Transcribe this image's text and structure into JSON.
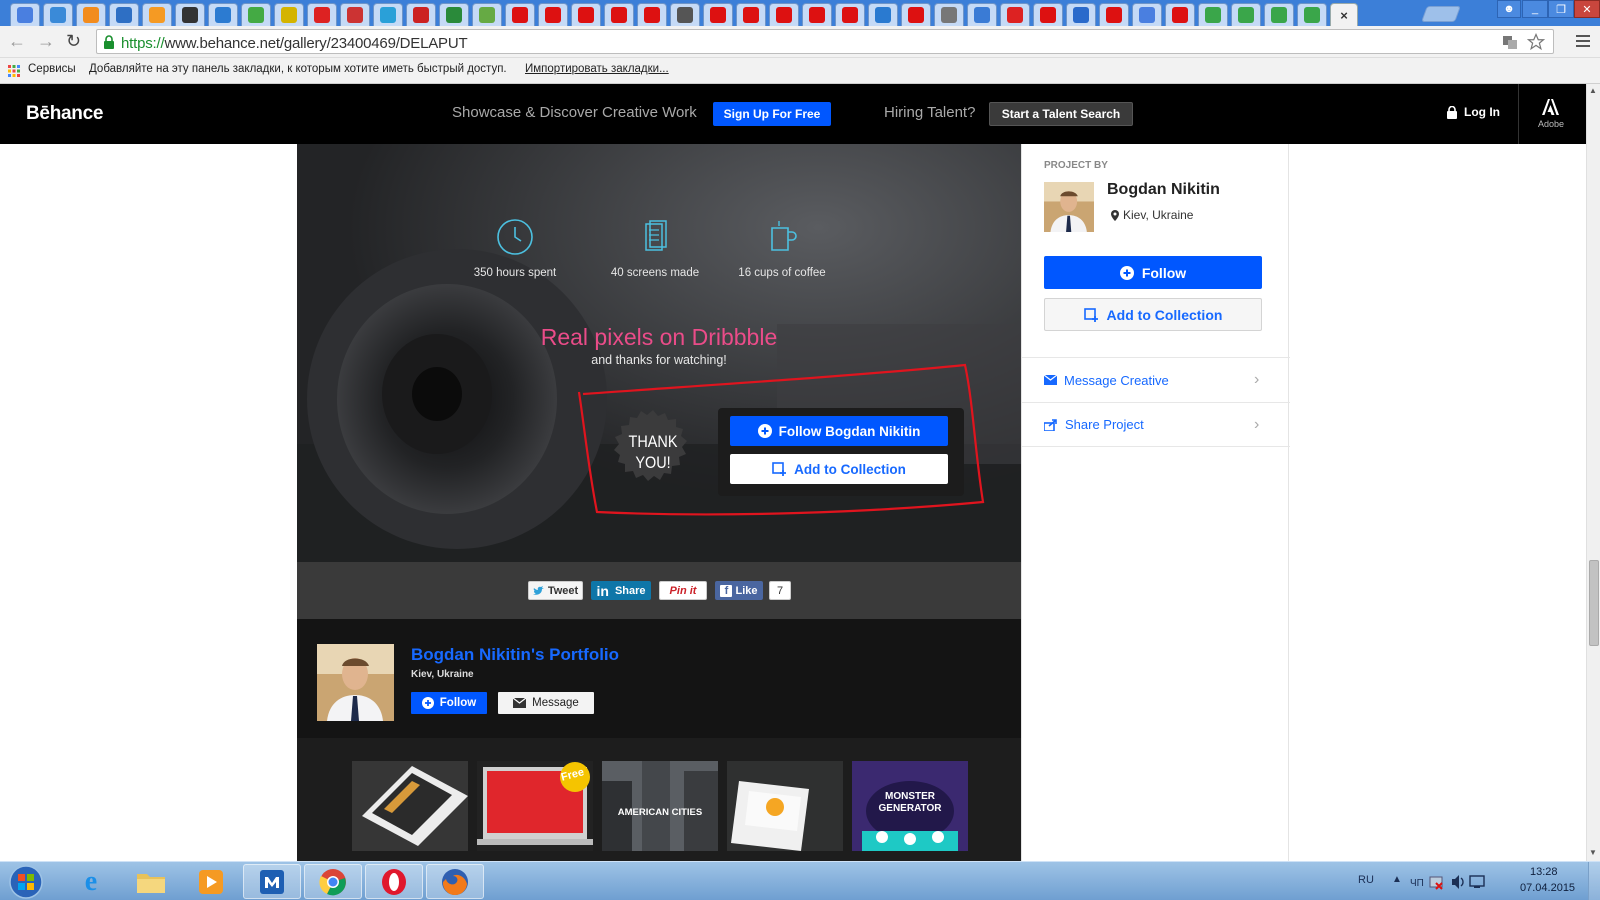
{
  "browser": {
    "active_tab_close": "×",
    "url_scheme": "https://",
    "url_rest": "www.behance.net/gallery/23400469/DELAPUT",
    "bookmarks_apps": "Сервисы",
    "bookmarks_hint": "Добавляйте на эту панель закладки, к которым хотите иметь быстрый доступ.",
    "bookmarks_import": "Импортировать закладки..."
  },
  "header": {
    "logo": "Bēhance",
    "tagline": "Showcase & Discover Creative Work",
    "signup": "Sign Up For Free",
    "hiring": "Hiring Talent?",
    "talent_search": "Start a Talent Search",
    "login": "Log In",
    "adobe": "Adobe"
  },
  "hero": {
    "stats": [
      {
        "text": "350 hours spent",
        "icon": "clock-icon"
      },
      {
        "text": "40 screens made",
        "icon": "screens-icon"
      },
      {
        "text": "16 cups of coffee",
        "icon": "coffee-cup-icon"
      }
    ],
    "title": "Real pixels on Dribbble",
    "subtitle": "and thanks for watching!",
    "badge": "THANK YOU!",
    "follow": "Follow Bogdan Nikitin",
    "add": "Add to Collection",
    "annotation_color": "#e0141e"
  },
  "share": {
    "tweet": "Tweet",
    "linkedin": "Share",
    "pinit": "Pin it",
    "like": "Like",
    "like_count": "7"
  },
  "owner": {
    "name": "Bogdan Nikitin's Portfolio",
    "location": "Kiev, Ukraine",
    "follow": "Follow",
    "message": "Message",
    "thumbs": [
      {
        "caption": ""
      },
      {
        "caption": "Free"
      },
      {
        "caption": "AMERICAN CITIES"
      },
      {
        "caption": ""
      },
      {
        "caption": "MONSTER GENERATOR"
      }
    ]
  },
  "sidebar": {
    "project_by": "PROJECT BY",
    "name": "Bogdan Nikitin",
    "location": "Kiev, Ukraine",
    "follow": "Follow",
    "add": "Add to Collection",
    "message": "Message Creative",
    "share": "Share Project"
  },
  "taskbar": {
    "lang": "RU",
    "time": "13:28",
    "date": "07.04.2015"
  },
  "colors": {
    "behance_blue": "#0057ff",
    "link_blue": "#1769ff",
    "dribbble_pink": "#ea4c89"
  }
}
